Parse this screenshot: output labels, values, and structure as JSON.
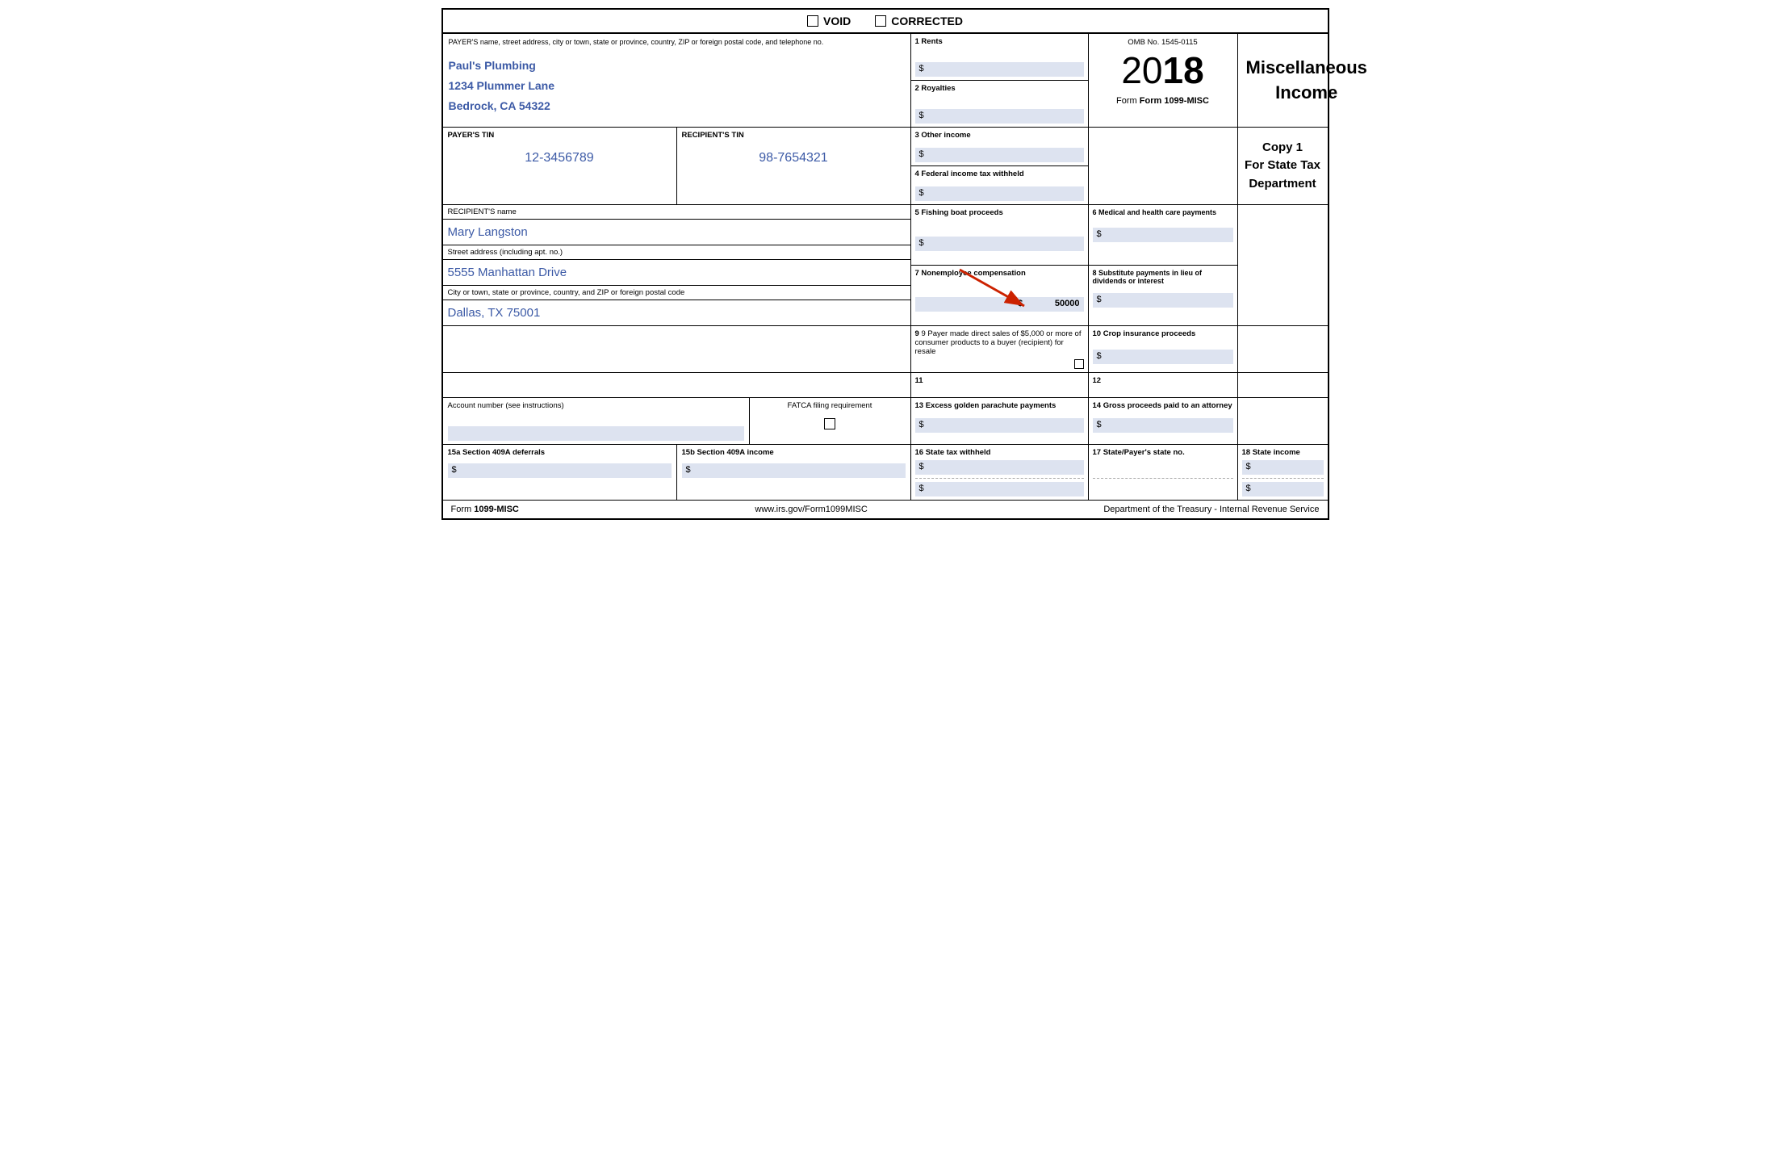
{
  "form": {
    "title": "Form 1099-MISC",
    "void_label": "VOID",
    "corrected_label": "CORRECTED",
    "omb_no": "OMB No. 1545-0115",
    "year": "2018",
    "year_prefix": "20",
    "year_suffix": "18",
    "form_name": "Form 1099-MISC",
    "misc_income_title": "Miscellaneous\nIncome",
    "misc_income_line1": "Miscellaneous",
    "misc_income_line2": "Income",
    "copy_title": "Copy 1",
    "copy_subtitle": "For State Tax\nDepartment",
    "copy_subtitle_line1": "For State Tax",
    "copy_subtitle_line2": "Department",
    "website": "www.irs.gov/Form1099MISC",
    "dept_label": "Department of the Treasury - Internal Revenue Service"
  },
  "payer": {
    "section_label": "PAYER'S name, street address, city or town, state or province, country, ZIP or foreign postal code, and telephone no.",
    "name": "Paul's Plumbing",
    "address": "1234 Plummer Lane",
    "city_state_zip": "Bedrock, CA 54322",
    "tin_label": "PAYER'S TIN",
    "tin_value": "12-3456789"
  },
  "recipient": {
    "tin_label": "RECIPIENT'S TIN",
    "tin_value": "98-7654321",
    "name_label": "RECIPIENT'S name",
    "name_value": "Mary Langston",
    "address_label": "Street address (including apt. no.)",
    "address_value": "5555 Manhattan Drive",
    "city_label": "City or town, state or province, country, and ZIP or foreign postal code",
    "city_value": "Dallas, TX 75001"
  },
  "boxes": {
    "box1_label": "1 Rents",
    "box1_value": "$",
    "box2_label": "2 Royalties",
    "box2_value": "$",
    "box3_label": "3 Other income",
    "box3_value": "$",
    "box4_label": "4 Federal income tax withheld",
    "box4_value": "$",
    "box5_label": "5 Fishing boat proceeds",
    "box5_value": "$",
    "box6_label": "6 Medical and health care payments",
    "box6_value": "$",
    "box7_label": "7 Nonemployee compensation",
    "box7_value": "$ 50000",
    "box7_dollar": "$",
    "box7_amount": "50000",
    "box8_label": "8 Substitute payments in lieu of dividends or interest",
    "box8_value": "$",
    "box9_label": "9 Payer made direct sales of $5,000 or more of consumer products to a buyer (recipient) for resale",
    "box10_label": "10 Crop insurance proceeds",
    "box10_value": "$",
    "box11_label": "11",
    "box12_label": "12",
    "box13_label": "13 Excess golden parachute payments",
    "box13_value": "$",
    "box14_label": "14 Gross proceeds paid to an attorney",
    "box14_value": "$",
    "box15a_label": "15a Section 409A deferrals",
    "box15a_value": "$",
    "box15b_label": "15b Section 409A income",
    "box15b_value": "$",
    "box16_label": "16 State tax withheld",
    "box16_value1": "$",
    "box16_value2": "$",
    "box17_label": "17 State/Payer's state no.",
    "box18_label": "18 State income",
    "box18_value1": "$",
    "box18_value2": "$"
  },
  "account": {
    "label": "Account number (see instructions)",
    "fatca_label": "FATCA filing requirement"
  }
}
